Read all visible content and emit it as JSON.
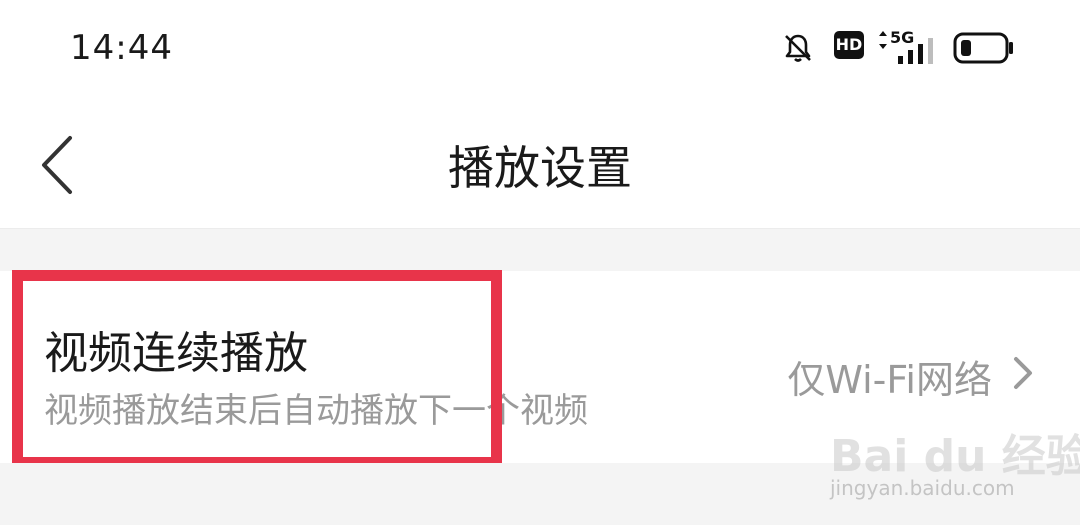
{
  "status_bar": {
    "time": "14:44",
    "hd_label": "HD",
    "network_label": "5G",
    "icons": [
      "bell-muted-icon",
      "hd-icon",
      "signal-5g-icon",
      "battery-icon"
    ]
  },
  "nav": {
    "title": "播放设置",
    "back_icon": "chevron-left-icon"
  },
  "setting": {
    "title": "视频连续播放",
    "description": "视频播放结束后自动播放下一个视频",
    "value": "仅Wi-Fi网络",
    "chevron_icon": "chevron-right-icon"
  },
  "overlay": {
    "highlight_color": "#e8344a"
  },
  "watermark": {
    "logo_text": "Bai du 经验",
    "url": "jingyan.baidu.com"
  }
}
